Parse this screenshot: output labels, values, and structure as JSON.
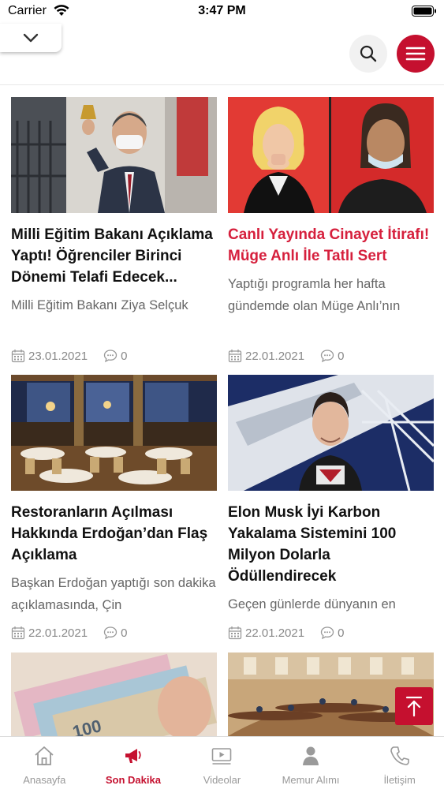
{
  "status_bar": {
    "carrier": "Carrier",
    "time": "3:47 PM"
  },
  "header": {
    "collapse_icon": "chevron-down-icon",
    "search_icon": "search-icon",
    "menu_icon": "hamburger-menu-icon",
    "accent_color": "#c5102f"
  },
  "articles": [
    {
      "title": "Milli Eğitim Bakanı Açıklama Yaptı! Öğrenciler Birinci Dönemi Telafi Edecek...",
      "summary": "Milli Eğitim Bakanı Ziya Selçuk",
      "date": "23.01.2021",
      "comments": "0",
      "image": "man in suit ringing bell wearing face mask",
      "active": false
    },
    {
      "title": "Canlı Yayında Cinayet İtirafı! Müge Anlı İle Tatlı Sert",
      "summary": "Yaptığı programla her hafta gündemde olan Müge Anlı’nın",
      "date": "22.01.2021",
      "comments": "0",
      "image": "tv split screen of two women",
      "active": true
    },
    {
      "title": "Restoranların Açılması Hakkında Erdoğan’dan Flaş Açıklama",
      "summary": "  Başkan Erdoğan yaptığı son dakika açıklamasında, Çin",
      "date": "22.01.2021",
      "comments": "0",
      "image": "restaurant interior with set tables",
      "active": false
    },
    {
      "title": "Elon Musk İyi Karbon Yakalama Sistemini 100 Milyon Dolarla Ödüllendirecek",
      "summary": "Geçen günlerde dünyanın en",
      "date": "22.01.2021",
      "comments": "0",
      "image": "man in front of rocket",
      "active": false
    },
    {
      "image": "turkish lira banknotes"
    },
    {
      "image": "parliament assembly hall"
    }
  ],
  "tabbar": [
    {
      "label": "Anasayfa",
      "icon": "home-icon",
      "active": false
    },
    {
      "label": "Son Dakika",
      "icon": "megaphone-icon",
      "active": true
    },
    {
      "label": "Videolar",
      "icon": "video-icon",
      "active": false
    },
    {
      "label": "Memur Alımı",
      "icon": "person-icon",
      "active": false
    },
    {
      "label": "İletişim",
      "icon": "phone-icon",
      "active": false
    }
  ]
}
